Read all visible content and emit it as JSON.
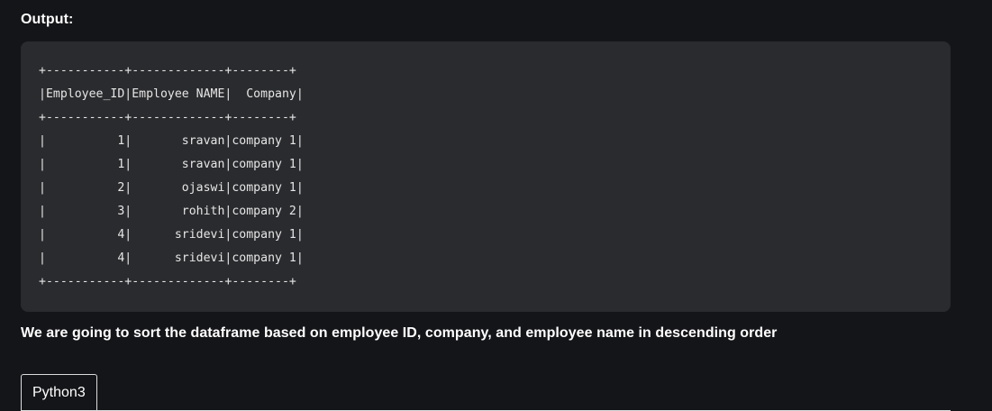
{
  "output_heading": "Output:",
  "output_lines": [
    "+-----------+-------------+--------+",
    "|Employee_ID|Employee NAME|  Company|",
    "+-----------+-------------+--------+",
    "|          1|       sravan|company 1|",
    "|          1|       sravan|company 1|",
    "|          2|       ojaswi|company 1|",
    "|          3|       rohith|company 2|",
    "|          4|      sridevi|company 1|",
    "|          4|      sridevi|company 1|",
    "+-----------+-------------+--------+"
  ],
  "description": "We are going to sort the dataframe based on employee ID, company, and employee name in descending order",
  "tabs": [
    {
      "label": "Python3"
    }
  ]
}
